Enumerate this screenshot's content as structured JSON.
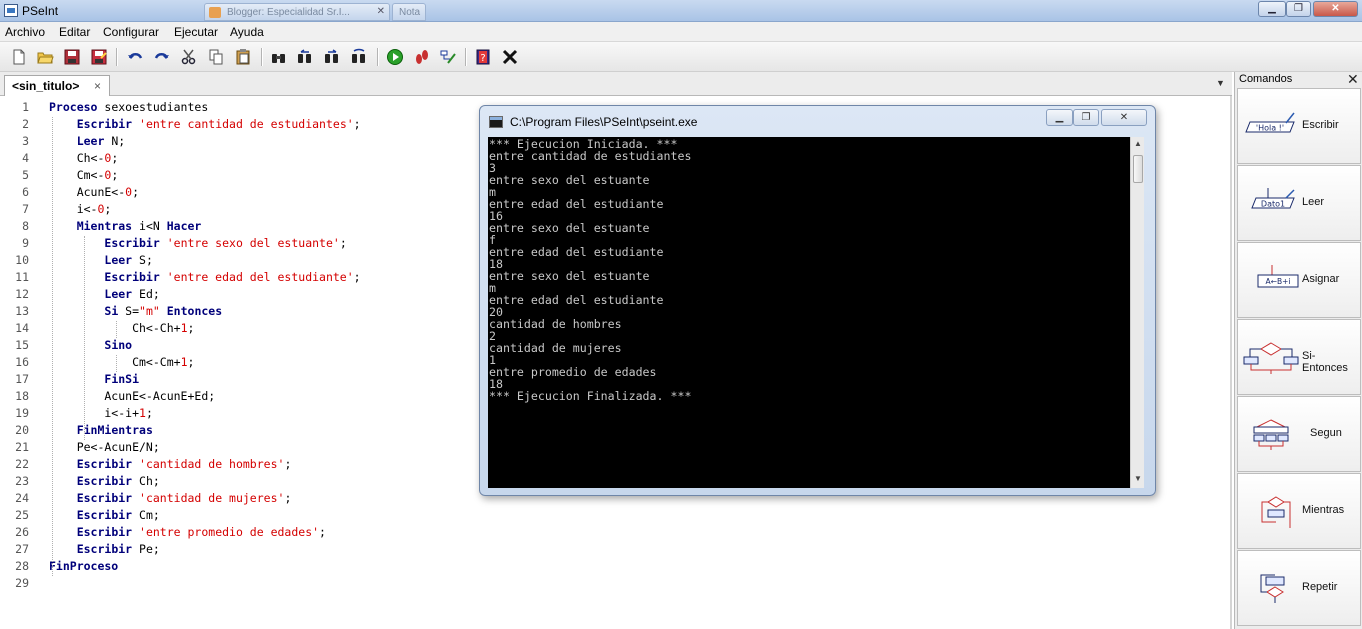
{
  "window": {
    "title": "PSeInt",
    "background_tab": "Blogger: Especialidad Sr.I...",
    "background_tab2": "Nota"
  },
  "menu": [
    "Archivo",
    "Editar",
    "Configurar",
    "Ejecutar",
    "Ayuda"
  ],
  "toolbar_icons": [
    "new-file-icon",
    "open-folder-icon",
    "save-icon",
    "save-as-icon",
    "undo-icon",
    "redo-icon",
    "cut-icon",
    "copy-icon",
    "paste-icon",
    "find-icon",
    "find-previous-icon",
    "find-next-icon",
    "replace-icon",
    "run-icon",
    "step-by-step-icon",
    "draw-flowchart-icon",
    "help-icon",
    "close-x-icon"
  ],
  "editor": {
    "tab_label": "<sin_titulo>",
    "tab_close": "×",
    "lines": [
      {
        "n": "1",
        "segments": [
          {
            "t": "Proceso",
            "c": "kw"
          },
          {
            "t": " sexoestudiantes"
          }
        ]
      },
      {
        "n": "2",
        "segments": [
          {
            "t": "    "
          },
          {
            "t": "Escribir",
            "c": "kw"
          },
          {
            "t": " "
          },
          {
            "t": "'entre cantidad de estudiantes'",
            "c": "str"
          },
          {
            "t": ";"
          }
        ]
      },
      {
        "n": "3",
        "segments": [
          {
            "t": "    "
          },
          {
            "t": "Leer",
            "c": "kw"
          },
          {
            "t": " N;"
          }
        ]
      },
      {
        "n": "4",
        "segments": [
          {
            "t": "    Ch<-"
          },
          {
            "t": "0",
            "c": "num"
          },
          {
            "t": ";"
          }
        ]
      },
      {
        "n": "5",
        "segments": [
          {
            "t": "    Cm<-"
          },
          {
            "t": "0",
            "c": "num"
          },
          {
            "t": ";"
          }
        ]
      },
      {
        "n": "6",
        "segments": [
          {
            "t": "    AcunE<-"
          },
          {
            "t": "0",
            "c": "num"
          },
          {
            "t": ";"
          }
        ]
      },
      {
        "n": "7",
        "segments": [
          {
            "t": "    i<-"
          },
          {
            "t": "0",
            "c": "num"
          },
          {
            "t": ";"
          }
        ]
      },
      {
        "n": "8",
        "segments": [
          {
            "t": "    "
          },
          {
            "t": "Mientras",
            "c": "kw"
          },
          {
            "t": " i<N "
          },
          {
            "t": "Hacer",
            "c": "kw"
          }
        ]
      },
      {
        "n": "9",
        "segments": [
          {
            "t": "        "
          },
          {
            "t": "Escribir",
            "c": "kw"
          },
          {
            "t": " "
          },
          {
            "t": "'entre sexo del estuante'",
            "c": "str"
          },
          {
            "t": ";"
          }
        ]
      },
      {
        "n": "10",
        "segments": [
          {
            "t": "        "
          },
          {
            "t": "Leer",
            "c": "kw"
          },
          {
            "t": " S;"
          }
        ]
      },
      {
        "n": "11",
        "segments": [
          {
            "t": "        "
          },
          {
            "t": "Escribir",
            "c": "kw"
          },
          {
            "t": " "
          },
          {
            "t": "'entre edad del estudiante'",
            "c": "str"
          },
          {
            "t": ";"
          }
        ]
      },
      {
        "n": "12",
        "segments": [
          {
            "t": "        "
          },
          {
            "t": "Leer",
            "c": "kw"
          },
          {
            "t": " Ed;"
          }
        ]
      },
      {
        "n": "13",
        "segments": [
          {
            "t": "        "
          },
          {
            "t": "Si",
            "c": "kw"
          },
          {
            "t": " S="
          },
          {
            "t": "\"m\"",
            "c": "str"
          },
          {
            "t": " "
          },
          {
            "t": "Entonces",
            "c": "kw"
          }
        ]
      },
      {
        "n": "14",
        "segments": [
          {
            "t": "            Ch<-Ch+"
          },
          {
            "t": "1",
            "c": "num"
          },
          {
            "t": ";"
          }
        ]
      },
      {
        "n": "15",
        "segments": [
          {
            "t": "        "
          },
          {
            "t": "Sino",
            "c": "kw"
          }
        ]
      },
      {
        "n": "16",
        "segments": [
          {
            "t": "            Cm<-Cm+"
          },
          {
            "t": "1",
            "c": "num"
          },
          {
            "t": ";"
          }
        ]
      },
      {
        "n": "17",
        "segments": [
          {
            "t": "        "
          },
          {
            "t": "FinSi",
            "c": "kw"
          }
        ]
      },
      {
        "n": "18",
        "segments": [
          {
            "t": "        AcunE<-AcunE+Ed;"
          }
        ]
      },
      {
        "n": "19",
        "segments": [
          {
            "t": "        i<-i+"
          },
          {
            "t": "1",
            "c": "num"
          },
          {
            "t": ";"
          }
        ]
      },
      {
        "n": "20",
        "segments": [
          {
            "t": "    "
          },
          {
            "t": "FinMientras",
            "c": "kw"
          }
        ]
      },
      {
        "n": "21",
        "segments": [
          {
            "t": "    Pe<-AcunE/N;"
          }
        ]
      },
      {
        "n": "22",
        "segments": [
          {
            "t": "    "
          },
          {
            "t": "Escribir",
            "c": "kw"
          },
          {
            "t": " "
          },
          {
            "t": "'cantidad de hombres'",
            "c": "str"
          },
          {
            "t": ";"
          }
        ]
      },
      {
        "n": "23",
        "segments": [
          {
            "t": "    "
          },
          {
            "t": "Escribir",
            "c": "kw"
          },
          {
            "t": " Ch;"
          }
        ]
      },
      {
        "n": "24",
        "segments": [
          {
            "t": "    "
          },
          {
            "t": "Escribir",
            "c": "kw"
          },
          {
            "t": " "
          },
          {
            "t": "'cantidad de mujeres'",
            "c": "str"
          },
          {
            "t": ";"
          }
        ]
      },
      {
        "n": "25",
        "segments": [
          {
            "t": "    "
          },
          {
            "t": "Escribir",
            "c": "kw"
          },
          {
            "t": " Cm;"
          }
        ]
      },
      {
        "n": "26",
        "segments": [
          {
            "t": "    "
          },
          {
            "t": "Escribir",
            "c": "kw"
          },
          {
            "t": " "
          },
          {
            "t": "'entre promedio de edades'",
            "c": "str"
          },
          {
            "t": ";"
          }
        ]
      },
      {
        "n": "27",
        "segments": [
          {
            "t": "    "
          },
          {
            "t": "Escribir",
            "c": "kw"
          },
          {
            "t": " Pe;"
          }
        ]
      },
      {
        "n": "28",
        "segments": [
          {
            "t": "FinProceso",
            "c": "kw"
          }
        ]
      },
      {
        "n": "29",
        "segments": []
      }
    ]
  },
  "console": {
    "title": "C:\\Program Files\\PSeInt\\pseint.exe",
    "lines": [
      "*** Ejecucion Iniciada. ***",
      "entre cantidad de estudiantes",
      "3",
      "entre sexo del estuante",
      "m",
      "entre edad del estudiante",
      "16",
      "entre sexo del estuante",
      "f",
      "entre edad del estudiante",
      "18",
      "entre sexo del estuante",
      "m",
      "entre edad del estudiante",
      "20",
      "cantidad de hombres",
      "2",
      "cantidad de mujeres",
      "1",
      "entre promedio de edades",
      "18",
      "*** Ejecucion Finalizada. ***"
    ]
  },
  "commands": {
    "title": "Comandos",
    "close": "✕",
    "items": [
      {
        "label": "Escribir",
        "icon": "escribir-icon",
        "icon_text": "'Hola !'"
      },
      {
        "label": "Leer",
        "icon": "leer-icon",
        "icon_text": "Dato1"
      },
      {
        "label": "Asignar",
        "icon": "asignar-icon",
        "icon_text": "A←B+i"
      },
      {
        "label": "Si-Entonces",
        "icon": "si-entonces-icon"
      },
      {
        "label": "Segun",
        "icon": "segun-icon"
      },
      {
        "label": "Mientras",
        "icon": "mientras-icon"
      },
      {
        "label": "Repetir",
        "icon": "repetir-icon"
      }
    ]
  },
  "colors": {
    "keyword": "#00007a",
    "string": "#d40000",
    "console_bg": "#000000",
    "console_text": "#c8c8c8"
  }
}
